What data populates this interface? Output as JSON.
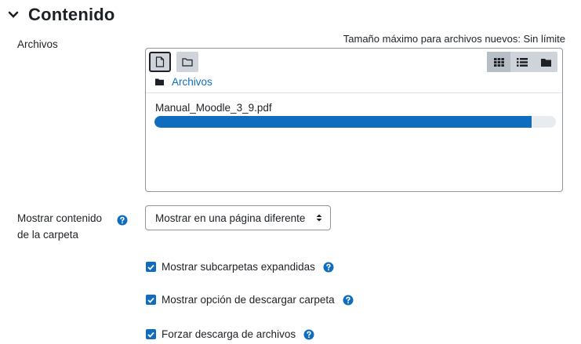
{
  "section": {
    "title": "Contenido"
  },
  "files": {
    "label": "Archivos",
    "max_size_text": "Tamaño máximo para archivos nuevos: Sin límite",
    "path_label": "Archivos",
    "upload": {
      "file_name": "Manual_Moodle_3_9.pdf",
      "progress_fraction": 0.94
    }
  },
  "display": {
    "label_line1": "Mostrar contenido",
    "label_line2": "de la carpeta",
    "selected_option": "Mostrar en una página diferente"
  },
  "options": [
    {
      "label": "Mostrar subcarpetas expandidas",
      "checked": true
    },
    {
      "label": "Mostrar opción de descargar carpeta",
      "checked": true
    },
    {
      "label": "Forzar descarga de archivos",
      "checked": true
    }
  ],
  "colors": {
    "accent": "#0f6cbf",
    "text": "#1d2125",
    "toolbar": "#ced4da"
  }
}
